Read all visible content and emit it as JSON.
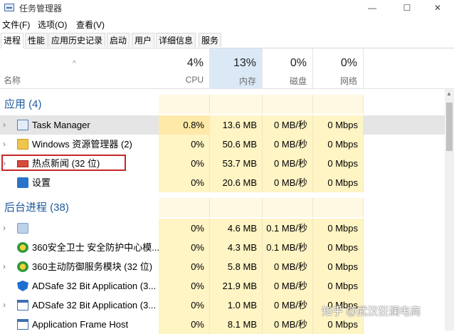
{
  "window": {
    "title": "任务管理器",
    "buttons": {
      "minimize": "—",
      "maximize": "☐",
      "close": "✕"
    }
  },
  "menu": [
    "文件(F)",
    "选项(O)",
    "查看(V)"
  ],
  "tabs": [
    "进程",
    "性能",
    "应用历史记录",
    "启动",
    "用户",
    "详细信息",
    "服务"
  ],
  "header": {
    "name": "名称",
    "cpu": {
      "pct": "4%",
      "label": "CPU"
    },
    "mem": {
      "pct": "13%",
      "label": "内存"
    },
    "disk": {
      "pct": "0%",
      "label": "磁盘"
    },
    "net": {
      "pct": "0%",
      "label": "网络"
    }
  },
  "sections": {
    "apps": "应用 (4)",
    "background": "后台进程 (38)"
  },
  "apps": [
    {
      "name": "Task Manager",
      "cpu": "0.8%",
      "mem": "13.6 MB",
      "disk": "0 MB/秒",
      "net": "0 Mbps",
      "icon": "task-manager-icon"
    },
    {
      "name": "Windows 资源管理器 (2)",
      "cpu": "0%",
      "mem": "50.6 MB",
      "disk": "0 MB/秒",
      "net": "0 Mbps",
      "icon": "folder-icon"
    },
    {
      "name": "热点新闻 (32 位)",
      "cpu": "0%",
      "mem": "53.7 MB",
      "disk": "0 MB/秒",
      "net": "0 Mbps",
      "icon": "news-icon"
    },
    {
      "name": "设置",
      "cpu": "0%",
      "mem": "20.6 MB",
      "disk": "0 MB/秒",
      "net": "0 Mbps",
      "icon": "settings-icon"
    }
  ],
  "background": [
    {
      "name": "",
      "cpu": "0%",
      "mem": "4.6 MB",
      "disk": "0.1 MB/秒",
      "net": "0 Mbps",
      "icon": "gear-icon"
    },
    {
      "name": "360安全卫士 安全防护中心模...",
      "cpu": "0%",
      "mem": "4.3 MB",
      "disk": "0.1 MB/秒",
      "net": "0 Mbps",
      "icon": "360-icon"
    },
    {
      "name": "360主动防御服务模块 (32 位)",
      "cpu": "0%",
      "mem": "5.8 MB",
      "disk": "0 MB/秒",
      "net": "0 Mbps",
      "icon": "360-icon"
    },
    {
      "name": "ADSafe 32 Bit Application (3...",
      "cpu": "0%",
      "mem": "21.9 MB",
      "disk": "0 MB/秒",
      "net": "0 Mbps",
      "icon": "adsafe-icon"
    },
    {
      "name": "ADSafe 32 Bit Application (3...",
      "cpu": "0%",
      "mem": "1.0 MB",
      "disk": "0 MB/秒",
      "net": "0 Mbps",
      "icon": "app-window-icon"
    },
    {
      "name": "Application Frame Host",
      "cpu": "0%",
      "mem": "8.1 MB",
      "disk": "0 MB/秒",
      "net": "0 Mbps",
      "icon": "app-window-icon"
    }
  ],
  "watermark": "知乎 @武汉狂澜电商"
}
